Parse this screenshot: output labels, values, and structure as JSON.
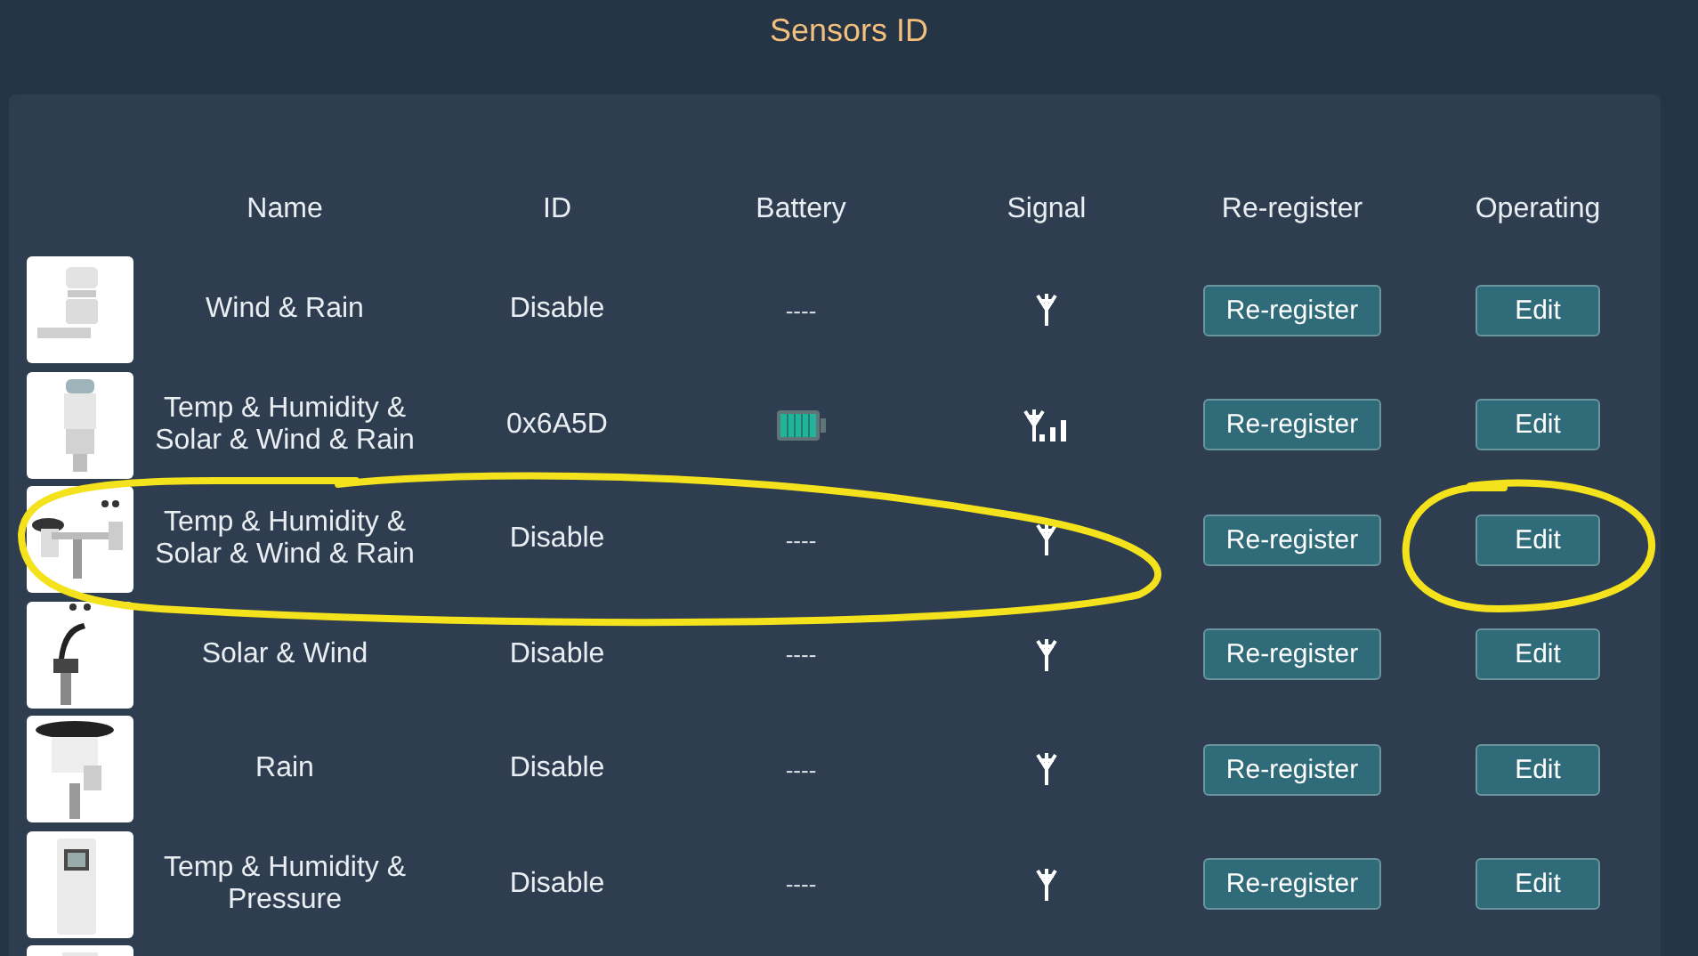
{
  "title": "Sensors ID",
  "table": {
    "columns": [
      "Name",
      "ID",
      "Battery",
      "Signal",
      "Re-register",
      "Operating"
    ],
    "rows": [
      {
        "name": "Wind & Rain",
        "id": "Disable",
        "battery": {
          "kind": "text",
          "text": "----"
        },
        "signal": {
          "kind": "antenna"
        },
        "reregister": "Re-register",
        "operating": "Edit"
      },
      {
        "name": "Temp & Humidity & Solar & Wind & Rain",
        "id": "0x6A5D",
        "battery": {
          "kind": "icon",
          "level": 1
        },
        "signal": {
          "kind": "antenna-bars"
        },
        "reregister": "Re-register",
        "operating": "Edit"
      },
      {
        "name": "Temp & Humidity & Solar & Wind & Rain",
        "id": "Disable",
        "battery": {
          "kind": "text",
          "text": "----"
        },
        "signal": {
          "kind": "antenna"
        },
        "reregister": "Re-register",
        "operating": "Edit"
      },
      {
        "name": "Solar & Wind",
        "id": "Disable",
        "battery": {
          "kind": "text",
          "text": "----"
        },
        "signal": {
          "kind": "antenna"
        },
        "reregister": "Re-register",
        "operating": "Edit"
      },
      {
        "name": "Rain",
        "id": "Disable",
        "battery": {
          "kind": "text",
          "text": "----"
        },
        "signal": {
          "kind": "antenna"
        },
        "reregister": "Re-register",
        "operating": "Edit"
      },
      {
        "name": "Temp & Humidity & Pressure",
        "id": "Disable",
        "battery": {
          "kind": "text",
          "text": "----"
        },
        "signal": {
          "kind": "antenna"
        },
        "reregister": "Re-register",
        "operating": "Edit"
      }
    ]
  }
}
